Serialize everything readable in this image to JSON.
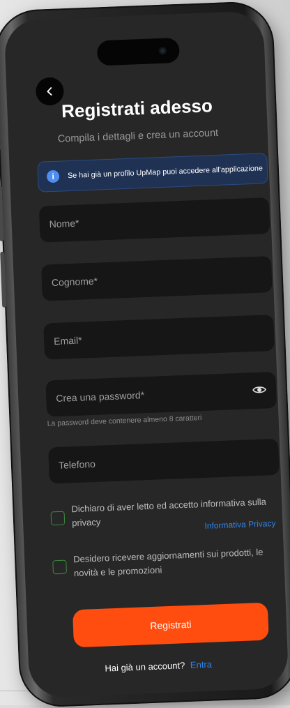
{
  "header": {
    "title": "Registrati adesso",
    "subtitle": "Compila i dettagli e crea un account"
  },
  "info": {
    "text": "Se hai già un profilo UpMap puoi accedere all'applicazione",
    "icon": "info-icon"
  },
  "fields": {
    "nome": "Nome*",
    "cognome": "Cognome*",
    "email": "Email*",
    "password": "Crea una password*",
    "password_hint": "La password deve contenere almeno 8 caratteri",
    "telefono": "Telefono"
  },
  "consents": {
    "privacy_label": "Dichiaro di aver letto ed accetto informativa sulla privacy",
    "privacy_link": "Informativa Privacy",
    "marketing_label": "Desidero ricevere aggiornamenti sui prodotti, le novità e le promozioni"
  },
  "actions": {
    "register": "Registrati",
    "have_account": "Hai già un account?",
    "login": "Entra"
  },
  "colors": {
    "accent": "#ff4d0f",
    "link": "#2f83e8",
    "checkbox": "#3b8a3f",
    "info_bg": "#1f3254"
  }
}
